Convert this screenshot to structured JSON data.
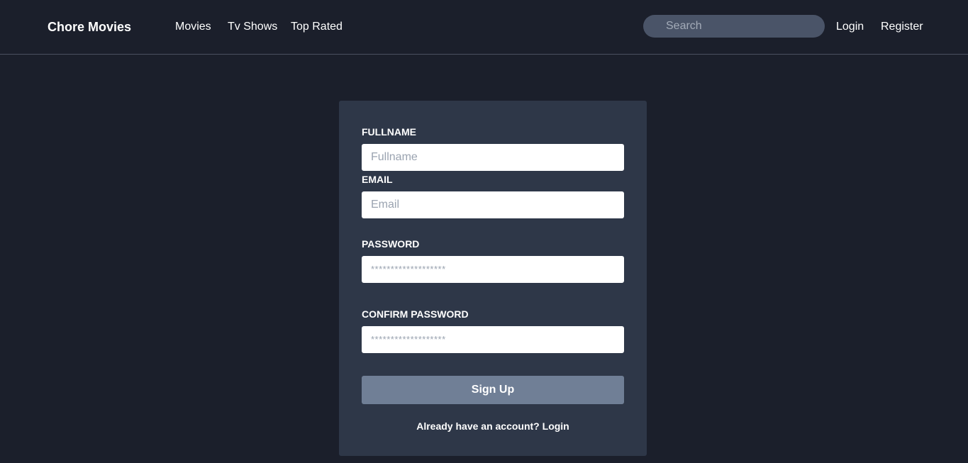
{
  "navbar": {
    "brand": "Chore Movies",
    "links": {
      "movies": "Movies",
      "tv_shows": "Tv Shows",
      "top_rated": "Top Rated",
      "login": "Login",
      "register": "Register"
    },
    "search": {
      "placeholder": "Search",
      "value": ""
    }
  },
  "form": {
    "fullname": {
      "label": "FULLNAME",
      "placeholder": "Fullname",
      "value": ""
    },
    "email": {
      "label": "EMAIL",
      "placeholder": "Email",
      "value": ""
    },
    "password": {
      "label": "PASSWORD",
      "placeholder": "*******************",
      "value": ""
    },
    "confirm_password": {
      "label": "CONFIRM PASSWORD",
      "placeholder": "*******************",
      "value": ""
    },
    "submit_label": "Sign Up",
    "footer_text": "Already have an account?",
    "footer_link": "Login"
  },
  "colors": {
    "background": "#1b1f2b",
    "card": "#2e3748",
    "button": "#707f96",
    "search_bg": "#4a5468"
  }
}
